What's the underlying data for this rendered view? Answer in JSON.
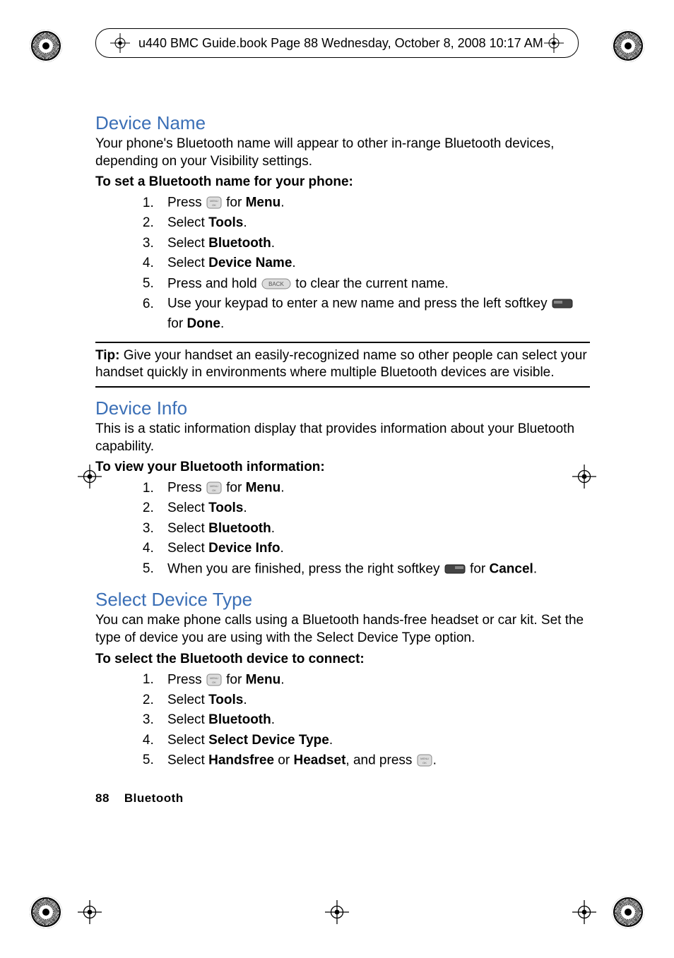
{
  "header": {
    "text": "u440 BMC Guide.book  Page 88  Wednesday, October 8, 2008  10:17 AM"
  },
  "sections": {
    "deviceName": {
      "heading": "Device Name",
      "intro": "Your phone's Bluetooth name will appear to other in-range Bluetooth devices, depending on your Visibility settings.",
      "sub": "To set a Bluetooth name for your phone:",
      "steps_pre": [
        "Press ",
        "Select ",
        "Select ",
        "Select ",
        "Press and hold ",
        "Use your keypad to enter a new name and press the left softkey "
      ],
      "steps_bold": [
        "Menu",
        "Tools",
        "Bluetooth",
        "Device Name",
        "",
        "Done"
      ],
      "steps_post": [
        " for ",
        ".",
        ".",
        ".",
        " to clear the current name.",
        "."
      ],
      "step6_prefix": "for "
    },
    "tip": {
      "label": "Tip:",
      "text": " Give your handset an easily-recognized name so other people can select your handset quickly in environments where multiple Bluetooth devices are visible."
    },
    "deviceInfo": {
      "heading": "Device Info",
      "intro": "This is a static information display that provides information about your Bluetooth capability.",
      "sub": "To view your Bluetooth information:",
      "steps": {
        "s1a": "Press ",
        "s1b": "Menu",
        "s1c": ".",
        "s2a": "Select ",
        "s2b": "Tools",
        "s2c": ".",
        "s3a": "Select ",
        "s3b": "Bluetooth",
        "s3c": ".",
        "s4a": "Select ",
        "s4b": "Device Info",
        "s4c": ".",
        "s5a": "When you are finished, press the right softkey ",
        "s5b": "Cancel",
        "s5c": "."
      }
    },
    "selectDevice": {
      "heading": "Select Device Type",
      "intro": "You can make phone calls using a Bluetooth hands-free headset or car kit. Set the type of device you are using with the Select Device Type option.",
      "sub": "To select the Bluetooth device to connect:",
      "steps": {
        "s1a": "Press ",
        "s1b": "Menu",
        "s1c": ".",
        "s2a": "Select ",
        "s2b": "Tools",
        "s2c": ".",
        "s3a": "Select ",
        "s3b": "Bluetooth",
        "s3c": ".",
        "s4a": "Select ",
        "s4b": "Select Device Type",
        "s4c": ".",
        "s5a": "Select ",
        "s5b": "Handsfree",
        "s5mid": " or ",
        "s5b2": "Headset",
        "s5c": ", and press ",
        "s5d": "."
      }
    }
  },
  "footer": {
    "pageNum": "88",
    "section": "Bluetooth"
  },
  "icons": {
    "menu_ok": "MENU OK",
    "back": "BACK",
    "softkey_left": "left softkey",
    "softkey_right": "right softkey"
  }
}
